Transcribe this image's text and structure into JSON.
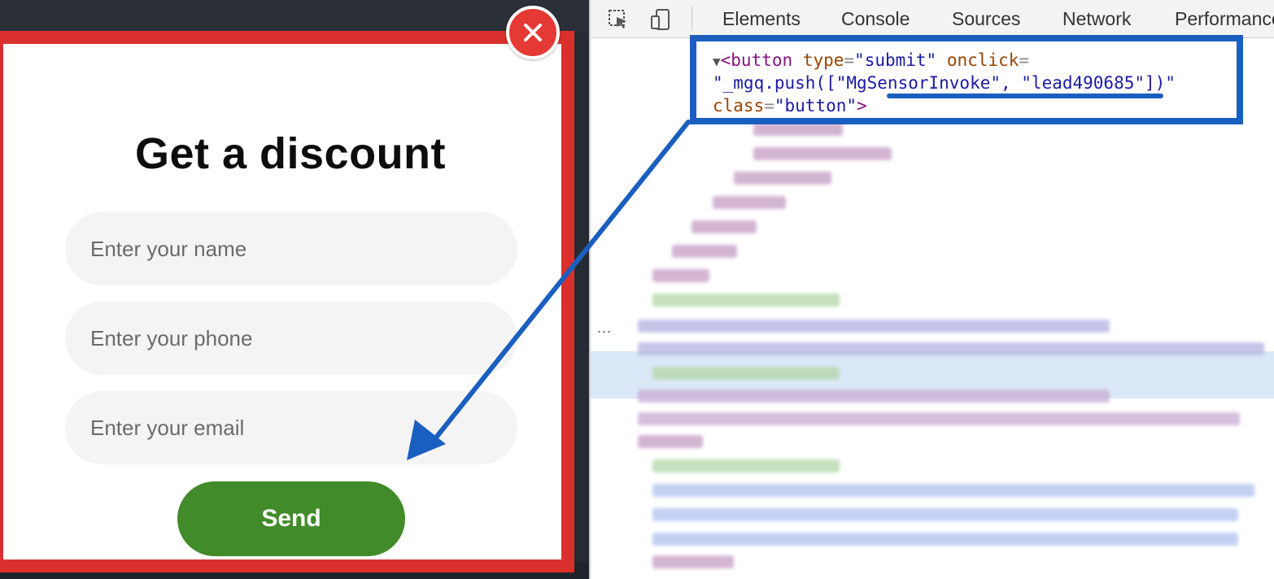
{
  "modal": {
    "title": "Get a discount",
    "name_placeholder": "Enter your name",
    "phone_placeholder": "Enter your phone",
    "email_placeholder": "Enter your email",
    "send_label": "Send"
  },
  "devtools": {
    "tabs": [
      "Elements",
      "Console",
      "Sources",
      "Network",
      "Performance"
    ],
    "code": {
      "line1_tag_open": "<button",
      "line1_attr1": "type",
      "line1_val1": "\"submit\"",
      "line1_attr2": "onclick",
      "line2_val": "\"_mgq.push([\"MgSensorInvoke\", \"lead490685\"])\"",
      "line3_attr": "class",
      "line3_val": "\"button\"",
      "line3_close": ">"
    },
    "row_ellipsis": "..."
  },
  "colors": {
    "modal_border": "#d9302e",
    "send_button": "#428b2a",
    "close_button": "#e53935",
    "highlight_blue": "#1a5fbf"
  }
}
